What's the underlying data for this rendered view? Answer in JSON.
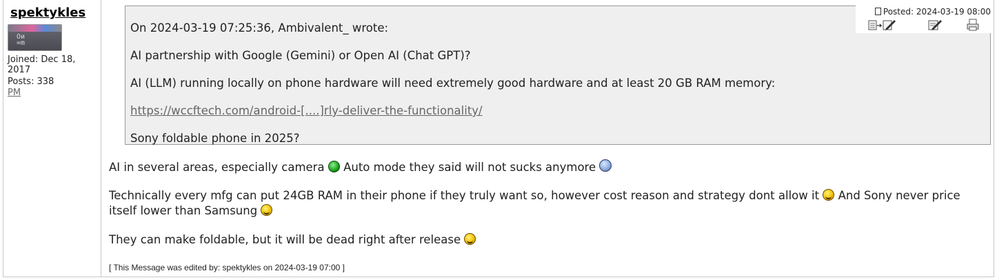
{
  "user": {
    "name": "spektykles",
    "joined_line1": "Joined: Dec 18,",
    "joined_line2": "2017",
    "posts": "Posts: 338",
    "pm": "PM"
  },
  "post_info": {
    "posted": "Posted: 2024-03-19 08:00",
    "icons": [
      "quote-reply-icon",
      "edit-icon",
      "print-icon"
    ]
  },
  "quote": {
    "header": "On 2024-03-19 07:25:36, Ambivalent_ wrote:",
    "lines": [
      "AI partnership with Google (Gemini) or Open AI (Chat GPT)?",
      "AI (LLM) running locally on phone hardware will need extremely good hardware and at least 20 GB RAM memory:"
    ],
    "link": "https://wccftech.com/android-[....]rly-deliver-the-functionality/",
    "last_line": "Sony foldable phone in 2025?"
  },
  "body": {
    "p1a": "AI in several areas, especially camera",
    "p1b": "Auto mode they said will not sucks anymore",
    "p2a": "Technically every mfg can put 24GB RAM in their phone if they truly want so, however cost reason and strategy dont allow it",
    "p2b": "And Sony never price",
    "p2c": "itself lower than Samsung",
    "p3": "They can make foldable, but it will be dead right after release"
  },
  "edited_note": "[ This Message was edited by: spektykles on 2024-03-19 07:00 ]"
}
